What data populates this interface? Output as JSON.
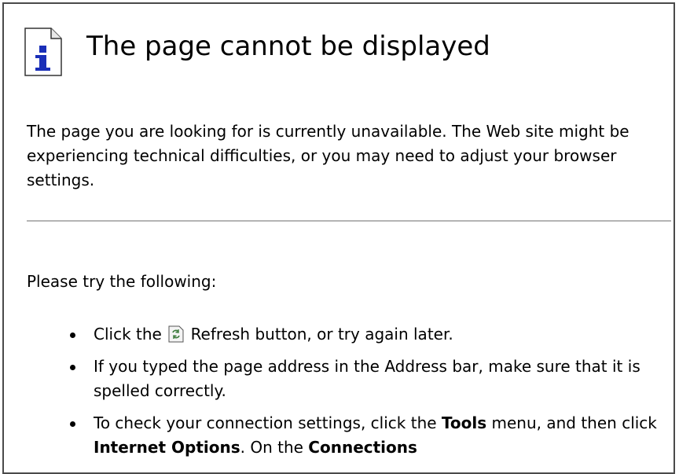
{
  "page": {
    "title": "The page cannot be displayed",
    "intro": "The page you are looking for is currently unavailable. The Web site might be experiencing technical difficulties, or you may need to adjust your browser settings.",
    "try_heading": "Please try the following:",
    "icons": {
      "header": "info-icon",
      "refresh": "refresh-icon"
    },
    "items": [
      {
        "before": "Click the",
        "after": "Refresh button, or try again later."
      },
      {
        "text": "If you typed the page address in the Address bar, make sure that it is spelled correctly."
      },
      {
        "p1": "To check your connection settings, click the ",
        "b1": "Tools",
        "p2": " menu, and then click ",
        "b2": "Internet Options",
        "p3": ". On the ",
        "b3": "Connections"
      }
    ]
  },
  "colors": {
    "border": "#4a4a4a",
    "divider": "#b4b4b4",
    "icon_blue": "#1a2fb8"
  }
}
